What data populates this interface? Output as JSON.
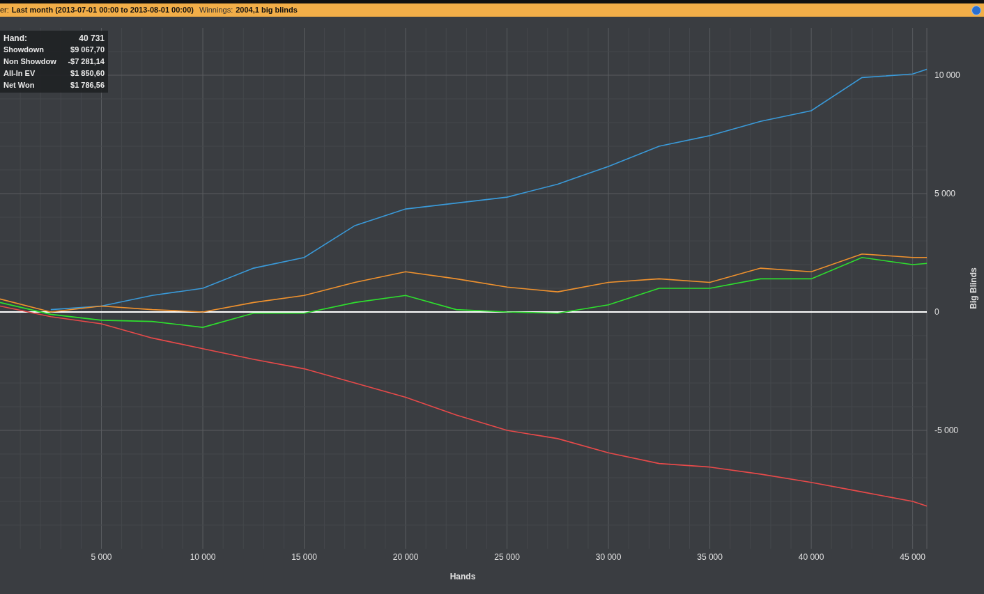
{
  "filter_bar": {
    "label_fragment": "er:",
    "period": "Last month (2013-07-01 00:00 to 2013-08-01 00:00)",
    "winnings_label": "Winnings:",
    "winnings_value": "2004,1 big blinds"
  },
  "graph": {
    "chart_data": {
      "type": "line",
      "xlabel": "Hands",
      "ylabel": "Big Blinds",
      "grid": true,
      "x": [
        0,
        2500,
        5000,
        7500,
        10000,
        12500,
        15000,
        17500,
        20000,
        22500,
        25000,
        27500,
        30000,
        32500,
        35000,
        37500,
        40000,
        42500,
        45000,
        45700
      ],
      "series": [
        {
          "color": "#3a9ad9",
          "values": [
            null,
            100,
            250,
            700,
            1000,
            1850,
            2300,
            3650,
            4350,
            4600,
            4850,
            5400,
            6150,
            7000,
            7450,
            8050,
            8500,
            9900,
            10050,
            10250
          ]
        },
        {
          "color": "#f0922e",
          "values": [
            550,
            0,
            250,
            100,
            0,
            400,
            700,
            1250,
            1700,
            1400,
            1050,
            850,
            1250,
            1400,
            1250,
            1850,
            1700,
            2450,
            2300,
            2300
          ]
        },
        {
          "color": "#2ee02e",
          "values": [
            400,
            -100,
            -350,
            -400,
            -650,
            -50,
            -50,
            400,
            700,
            100,
            0,
            -50,
            300,
            1000,
            1000,
            1400,
            1400,
            2300,
            2000,
            2050
          ]
        },
        {
          "color": "#e84a4a",
          "values": [
            250,
            -200,
            -500,
            -1100,
            -1550,
            -2000,
            -2400,
            -3000,
            -3600,
            -4350,
            -5000,
            -5350,
            -5950,
            -6400,
            -6550,
            -6850,
            -7200,
            -7600,
            -8000,
            -8200
          ]
        }
      ],
      "xlim": [
        0,
        45700
      ],
      "ylim": [
        -10000,
        12000
      ],
      "xticks": [
        {
          "value": 5000,
          "label": "5 000"
        },
        {
          "value": 10000,
          "label": "10 000"
        },
        {
          "value": 15000,
          "label": "15 000"
        },
        {
          "value": 20000,
          "label": "20 000"
        },
        {
          "value": 25000,
          "label": "25 000"
        },
        {
          "value": 30000,
          "label": "30 000"
        },
        {
          "value": 35000,
          "label": "35 000"
        },
        {
          "value": 40000,
          "label": "40 000"
        },
        {
          "value": 45000,
          "label": "45 000"
        }
      ],
      "yticks": [
        {
          "value": -5000,
          "label": "-5 000"
        },
        {
          "value": 0,
          "label": "0"
        },
        {
          "value": 5000,
          "label": "5 000"
        },
        {
          "value": 10000,
          "label": "10 000"
        }
      ]
    },
    "tooltip": [
      {
        "label": "Hand:",
        "value": "40 731"
      },
      {
        "label": "Showdown",
        "value": "$9 067,70"
      },
      {
        "label": "Non Showdow",
        "value": "-$7 281,14"
      },
      {
        "label": "All-In EV",
        "value": "$1 850,60"
      },
      {
        "label": "Net Won",
        "value": "$1 786,56"
      }
    ]
  }
}
